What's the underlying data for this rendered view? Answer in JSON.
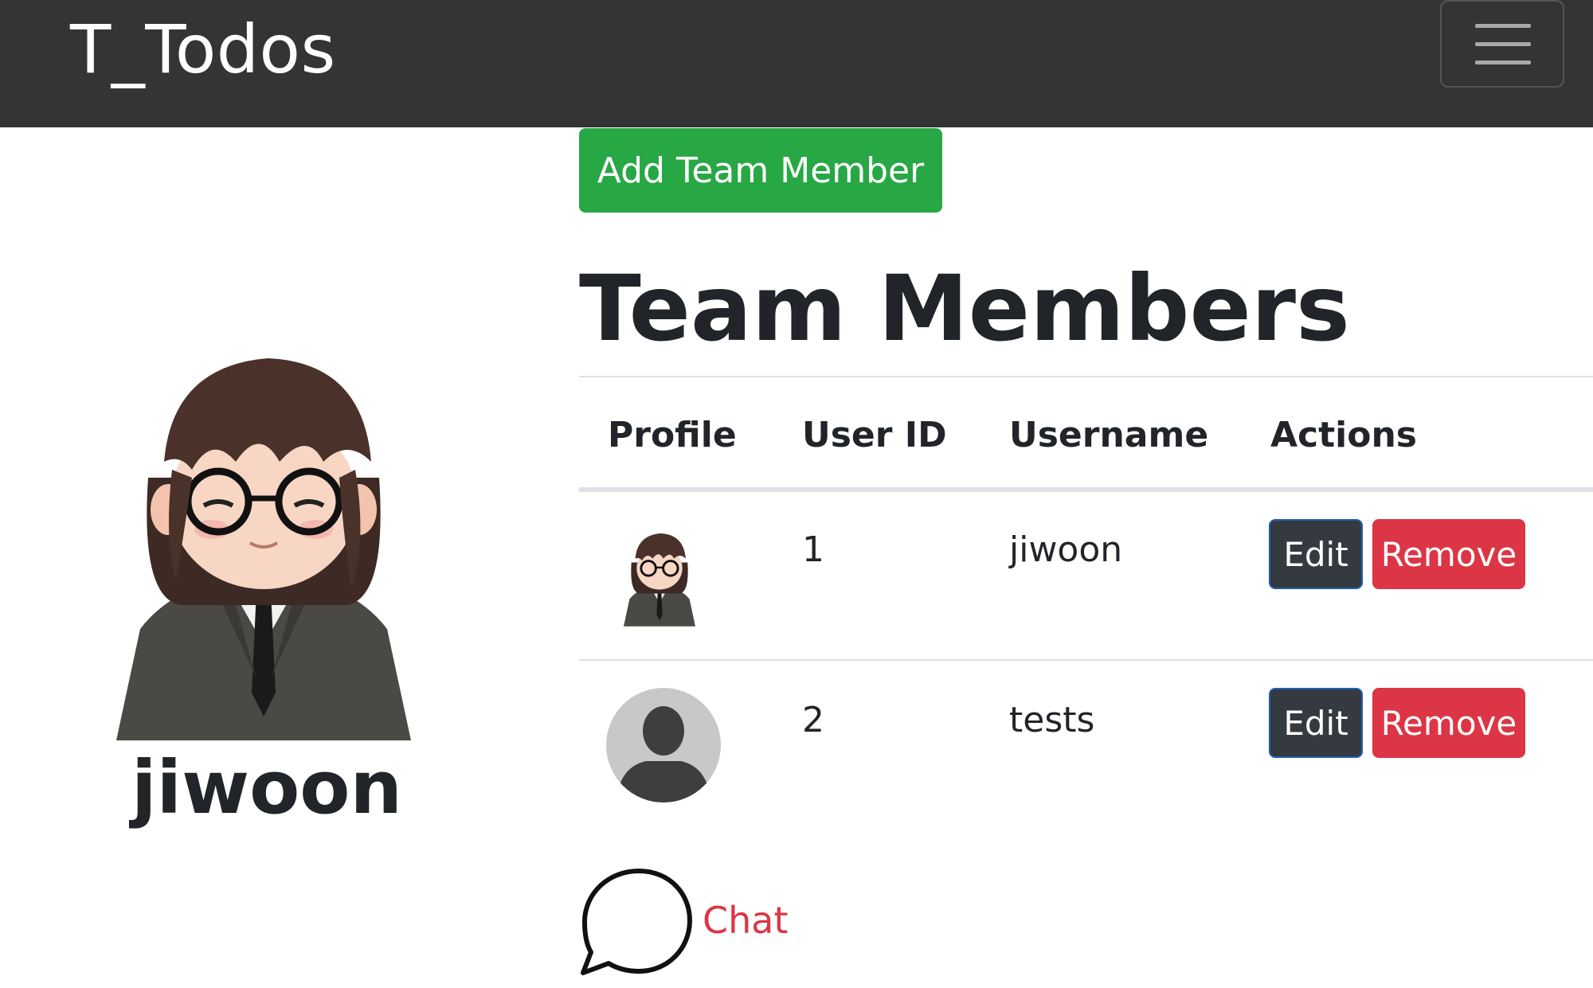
{
  "navbar": {
    "brand": "T_Todos",
    "menu_icon": "hamburger-menu-icon"
  },
  "profile": {
    "name": "jiwoon",
    "avatar_icon": "cartoon-avatar-icon"
  },
  "actions": {
    "add_label": "Add Team Member"
  },
  "page": {
    "title": "Team Members"
  },
  "table": {
    "headers": [
      "Profile",
      "User ID",
      "Username",
      "Actions"
    ],
    "rows": [
      {
        "avatar": "cartoon-avatar-icon",
        "user_id": "1",
        "username": "jiwoon",
        "edit_label": "Edit",
        "remove_label": "Remove"
      },
      {
        "avatar": "default-user-icon",
        "user_id": "2",
        "username": "tests",
        "edit_label": "Edit",
        "remove_label": "Remove"
      }
    ]
  },
  "chat": {
    "label": "Chat",
    "icon": "chat-bubble-icon"
  },
  "colors": {
    "navbar_bg": "#343434",
    "success": "#28a745",
    "danger": "#dc3545",
    "dark": "#343a40"
  }
}
